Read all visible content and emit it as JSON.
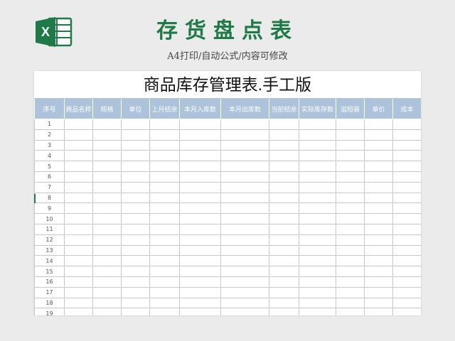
{
  "header": {
    "title": "存货盘点表",
    "subtitle": "A4打印/自动公式/内容可修改"
  },
  "icon": {
    "name": "excel-icon",
    "color": "#1e7a46",
    "letter": "X"
  },
  "sheet": {
    "title": "商品库存管理表.手工版",
    "columns": [
      "序号",
      "商品名称",
      "规格",
      "单位",
      "上月结余",
      "本月入库数",
      "本月出库数",
      "当前结余",
      "实际库存数",
      "溢短装",
      "单价",
      "成本"
    ],
    "row_numbers": [
      "1",
      "2",
      "3",
      "4",
      "5",
      "6",
      "7",
      "8",
      "9",
      "10",
      "11",
      "12",
      "13",
      "14",
      "15",
      "16",
      "17",
      "18",
      "19"
    ]
  },
  "colors": {
    "accent": "#1e7a46",
    "header_fill": "#adc2db",
    "background": "#ebebeb"
  }
}
